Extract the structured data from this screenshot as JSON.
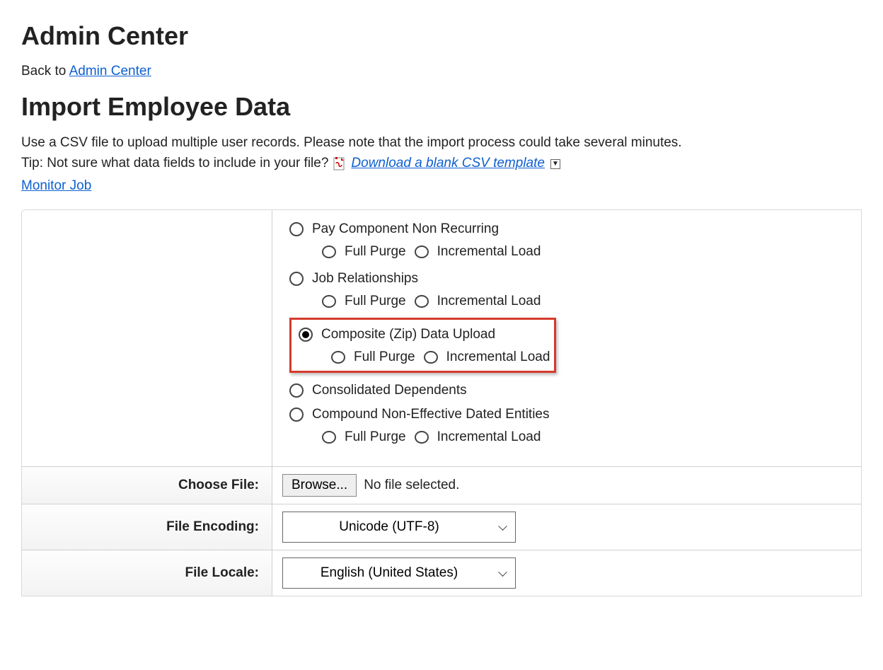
{
  "header": {
    "admin_center": "Admin Center",
    "back_prefix": "Back to ",
    "back_link": "Admin Center",
    "page_title": "Import Employee Data"
  },
  "intro": {
    "line1": "Use a CSV file to upload multiple user records. Please note that the import process could take several minutes.",
    "tip_prefix": "  Tip: Not sure what data fields to include in your file? ",
    "download_link": "Download a blank CSV template",
    "monitor_link": "Monitor Job"
  },
  "options": {
    "items": [
      {
        "label": "Pay Component Non Recurring",
        "selected": false,
        "sub": true
      },
      {
        "label": "Job Relationships",
        "selected": false,
        "sub": true
      },
      {
        "label": "Composite (Zip) Data Upload",
        "selected": true,
        "sub": true,
        "highlight": true
      },
      {
        "label": "Consolidated Dependents",
        "selected": false,
        "sub": false
      },
      {
        "label": "Compound Non-Effective Dated Entities",
        "selected": false,
        "sub": true
      }
    ],
    "sub_full": "Full Purge",
    "sub_incr": "Incremental Load"
  },
  "file": {
    "label": "Choose File:",
    "browse": "Browse...",
    "status": "No file selected."
  },
  "encoding": {
    "label": "File Encoding:",
    "value": "Unicode (UTF-8)"
  },
  "locale": {
    "label": "File Locale:",
    "value": "English (United States)"
  }
}
